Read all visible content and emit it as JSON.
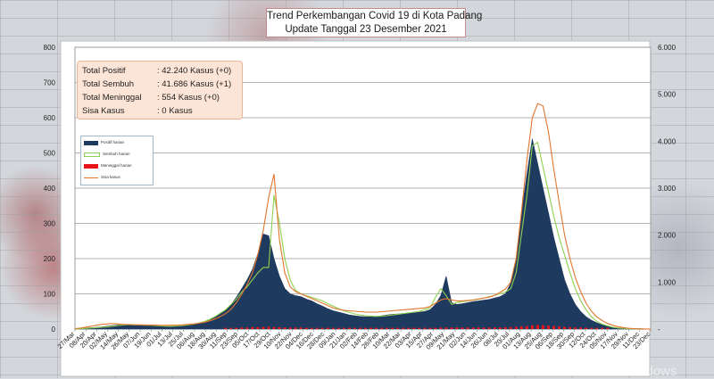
{
  "title": {
    "line1": "Trend Perkembangan Covid 19 di Kota Padang",
    "line2": "Update Tanggal 23 Desember 2021"
  },
  "stats": [
    {
      "label": "Total Positif",
      "value": ": 42.240 Kasus (+0)"
    },
    {
      "label": "Total Sembuh",
      "value": ": 41.686 Kasus (+1)"
    },
    {
      "label": "Total Meninggal",
      "value": ": 554 Kasus (+0)"
    },
    {
      "label": "Sisa Kasus",
      "value": ":   0 Kasus"
    }
  ],
  "watermark": "Activate Windows",
  "colors": {
    "positif": "#1f3a5f",
    "sembuh": "#8fd14f",
    "meninggal": "#e8141a",
    "sisa": "#e2762f"
  },
  "chart_data": {
    "type": "area",
    "legend_placement": "top-left",
    "grid": true,
    "y_left": {
      "range": [
        0,
        800
      ],
      "ticks": [
        "0",
        "100",
        "200",
        "300",
        "400",
        "500",
        "600",
        "700",
        "800"
      ]
    },
    "y_right": {
      "range": [
        0,
        6000
      ],
      "ticks": [
        "-",
        "1.000",
        "2.000",
        "3.000",
        "4.000",
        "5.000",
        "6.000"
      ]
    },
    "x_ticks": [
      "27/Mar",
      "08/Apr",
      "20/Apr",
      "02/May",
      "14/May",
      "26/May",
      "07/Jun",
      "19/Jun",
      "01/Jul",
      "13/Jul",
      "25/Jul",
      "06/Aug",
      "18/Aug",
      "30/Aug",
      "11/Sep",
      "23/Sep",
      "05/Oct",
      "17/Oct",
      "29/Oct",
      "10/Nov",
      "22/Nov",
      "04/Dec",
      "16/Dec",
      "28/Dec",
      "09/Jan",
      "21/Jan",
      "02/Feb",
      "14/Feb",
      "26/Feb",
      "10/Mar",
      "22/Mar",
      "03/Apr",
      "15/Apr",
      "27/Apr",
      "09/May",
      "21/May",
      "02/Jun",
      "14/Jun",
      "26/Jun",
      "08/Jul",
      "20/Jul",
      "01/Aug",
      "13/Aug",
      "25/Aug",
      "06/Sep",
      "18/Sep",
      "30/Sep",
      "12/Oct",
      "24/Oct",
      "05/Nov",
      "17/Nov",
      "29/Nov",
      "11/Dec",
      "23/Dec"
    ],
    "series": [
      {
        "name": "Positif harian",
        "axis": "left",
        "values": [
          1,
          2,
          3,
          4,
          5,
          6,
          8,
          10,
          12,
          13,
          12,
          12,
          11,
          10,
          10,
          9,
          8,
          8,
          8,
          9,
          10,
          12,
          14,
          17,
          21,
          27,
          35,
          45,
          55,
          70,
          90,
          115,
          140,
          170,
          215,
          270,
          265,
          200,
          150,
          115,
          100,
          95,
          92,
          85,
          80,
          72,
          65,
          58,
          52,
          48,
          44,
          40,
          38,
          36,
          35,
          35,
          36,
          38,
          40,
          42,
          43,
          44,
          45,
          46,
          48,
          50,
          55,
          70,
          95,
          150,
          75,
          70,
          72,
          75,
          78,
          80,
          82,
          84,
          88,
          92,
          100,
          130,
          200,
          330,
          440,
          540,
          470,
          400,
          330,
          260,
          200,
          140,
          100,
          70,
          50,
          35,
          25,
          18,
          12,
          8,
          5,
          3,
          2,
          1,
          1,
          1,
          0,
          0
        ]
      },
      {
        "name": "Sembuh harian",
        "axis": "left",
        "values": [
          0,
          1,
          2,
          3,
          4,
          5,
          6,
          8,
          10,
          12,
          13,
          12,
          12,
          11,
          11,
          10,
          9,
          8,
          8,
          9,
          10,
          12,
          14,
          17,
          21,
          27,
          35,
          45,
          55,
          70,
          85,
          105,
          120,
          140,
          160,
          175,
          175,
          380,
          300,
          200,
          140,
          110,
          100,
          95,
          90,
          85,
          80,
          72,
          65,
          58,
          52,
          47,
          43,
          40,
          38,
          37,
          36,
          37,
          38,
          40,
          42,
          44,
          46,
          48,
          50,
          55,
          60,
          90,
          115,
          95,
          70,
          75,
          78,
          80,
          82,
          85,
          88,
          92,
          96,
          100,
          105,
          115,
          160,
          270,
          380,
          520,
          530,
          460,
          390,
          320,
          260,
          210,
          160,
          115,
          80,
          55,
          35,
          22,
          14,
          9,
          5,
          3,
          2,
          1,
          1,
          1,
          0,
          0
        ]
      },
      {
        "name": "Meninggal harian",
        "axis": "left",
        "values": [
          0,
          0,
          0,
          0,
          0,
          0,
          0,
          0,
          0,
          0,
          0,
          0,
          0,
          0,
          0,
          0,
          0,
          0,
          0,
          0,
          0,
          0,
          0,
          0,
          0,
          0,
          0,
          0,
          1,
          1,
          1,
          2,
          2,
          3,
          3,
          4,
          4,
          3,
          3,
          2,
          2,
          2,
          2,
          1,
          1,
          1,
          1,
          1,
          1,
          1,
          1,
          1,
          1,
          1,
          1,
          1,
          1,
          1,
          1,
          1,
          1,
          1,
          1,
          1,
          1,
          1,
          1,
          1,
          2,
          2,
          2,
          2,
          2,
          2,
          2,
          2,
          2,
          2,
          2,
          2,
          3,
          3,
          4,
          5,
          6,
          8,
          9,
          8,
          7,
          6,
          5,
          4,
          3,
          2,
          2,
          1,
          1,
          1,
          1,
          1,
          0,
          0,
          0,
          0,
          0,
          0,
          0,
          0
        ]
      },
      {
        "name": "Sisa kasus",
        "axis": "right",
        "values": [
          10,
          20,
          40,
          60,
          80,
          100,
          110,
          115,
          110,
          100,
          95,
          95,
          90,
          90,
          85,
          85,
          80,
          80,
          82,
          85,
          90,
          100,
          110,
          125,
          145,
          175,
          215,
          265,
          330,
          420,
          560,
          740,
          950,
          1200,
          1600,
          2100,
          2800,
          3300,
          1900,
          1200,
          900,
          800,
          750,
          700,
          650,
          600,
          550,
          500,
          450,
          420,
          400,
          390,
          380,
          370,
          360,
          360,
          360,
          370,
          380,
          390,
          400,
          410,
          420,
          430,
          440,
          450,
          480,
          550,
          620,
          650,
          620,
          600,
          600,
          610,
          620,
          640,
          660,
          680,
          720,
          780,
          850,
          1000,
          1500,
          2500,
          3600,
          4500,
          4800,
          4750,
          4200,
          3400,
          2700,
          2000,
          1500,
          1100,
          800,
          550,
          380,
          260,
          180,
          120,
          80,
          50,
          30,
          15,
          8,
          4,
          2,
          0
        ]
      }
    ]
  }
}
